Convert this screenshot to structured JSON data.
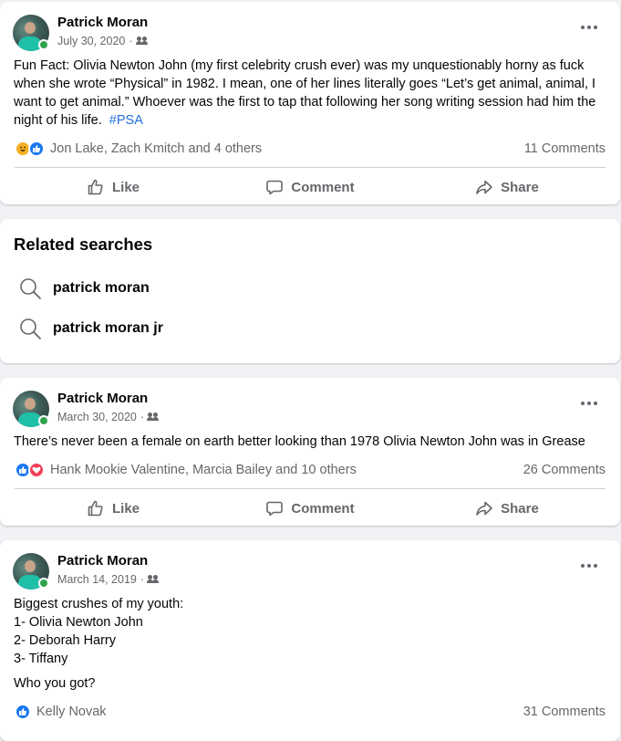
{
  "posts": [
    {
      "author": "Patrick Moran",
      "date": "July 30, 2020",
      "text": "Fun Fact: Olivia Newton John (my first celebrity crush ever) was my unquestionably horny as fuck when she wrote “Physical” in 1982. I mean, one of her lines literally goes “Let’s get animal, animal, I want to get animal.” Whoever was the first to tap that following her song writing session had him the night of his life.",
      "hashtag": "#PSA",
      "reactions_text": "Jon Lake, Zach Kmitch and 4 others",
      "comments": "11 Comments",
      "like_label": "Like",
      "comment_label": "Comment",
      "share_label": "Share"
    },
    {
      "author": "Patrick Moran",
      "date": "March 30, 2020",
      "text": "There’s never been a female on earth better looking than 1978 Olivia Newton John was in Grease",
      "reactions_text": "Hank Mookie Valentine, Marcia Bailey and 10 others",
      "comments": "26 Comments",
      "like_label": "Like",
      "comment_label": "Comment",
      "share_label": "Share"
    },
    {
      "author": "Patrick Moran",
      "date": "March 14, 2019",
      "lines": [
        "Biggest crushes of my youth:",
        "1- Olivia Newton John",
        "2- Deborah Harry",
        "3- Tiffany"
      ],
      "question": "Who you got?",
      "reactions_text": "Kelly Novak",
      "comments": "31 Comments"
    }
  ],
  "related": {
    "title": "Related searches",
    "items": [
      "patrick moran",
      "patrick moran jr"
    ]
  },
  "colors": {
    "background": "#f0f2f5",
    "link": "#216fdb",
    "like_blue": "#1877f2",
    "love_red": "#f33e58",
    "online_green": "#31a24c",
    "secondary_text": "#65676b"
  }
}
